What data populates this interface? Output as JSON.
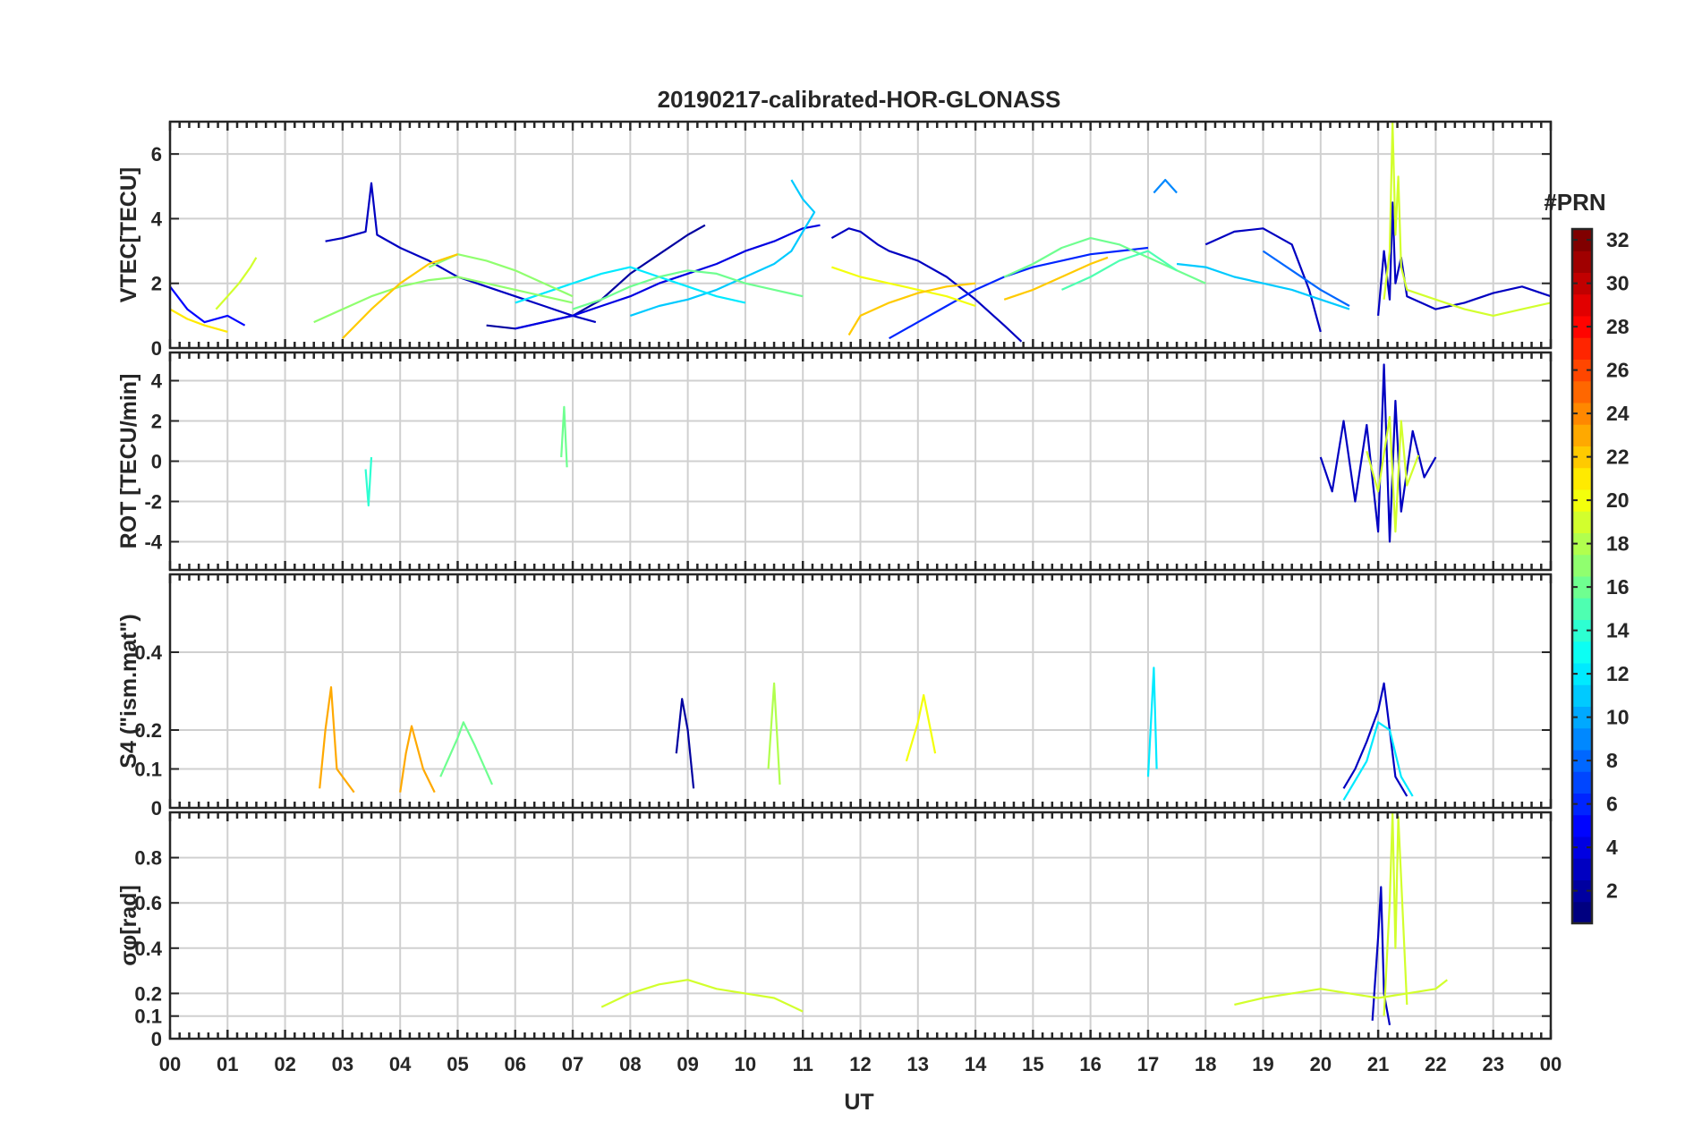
{
  "chart_data": {
    "type": "line",
    "title": "20190217-calibrated-HOR-GLONASS",
    "xlabel": "UT",
    "x_ticks": [
      "00",
      "01",
      "02",
      "03",
      "04",
      "05",
      "06",
      "07",
      "08",
      "09",
      "10",
      "11",
      "12",
      "13",
      "14",
      "15",
      "16",
      "17",
      "18",
      "19",
      "20",
      "21",
      "22",
      "23",
      "00"
    ],
    "xlim": [
      0,
      24
    ],
    "colorbar": {
      "title": "#PRN",
      "ticks": [
        "2",
        "4",
        "6",
        "8",
        "10",
        "12",
        "14",
        "16",
        "18",
        "20",
        "22",
        "24",
        "26",
        "28",
        "30",
        "32"
      ],
      "range": [
        1,
        32
      ],
      "colormap": "jet"
    },
    "panels": [
      {
        "ylabel": "VTEC[TECU]",
        "ylim": [
          0,
          7
        ],
        "yticks": [
          "0",
          "2",
          "4",
          "6"
        ],
        "ytick_values": [
          0,
          2,
          4,
          6
        ],
        "series": [
          {
            "prn": 3,
            "x": [
              2.7,
              3.0,
              3.4,
              3.5,
              3.6,
              4.0,
              4.5,
              5.0,
              5.5,
              6.0,
              6.5,
              7.0,
              7.4
            ],
            "y": [
              3.3,
              3.4,
              3.6,
              5.1,
              3.5,
              3.1,
              2.7,
              2.2,
              1.9,
              1.6,
              1.3,
              1.0,
              0.8
            ]
          },
          {
            "prn": 2,
            "x": [
              5.5,
              6.0,
              6.5,
              7.0,
              7.5,
              8.0,
              8.5,
              9.0,
              9.3
            ],
            "y": [
              0.7,
              0.6,
              0.8,
              1.0,
              1.5,
              2.3,
              2.9,
              3.5,
              3.8
            ]
          },
          {
            "prn": 4,
            "x": [
              6.0,
              6.5,
              7.0,
              7.5,
              8.0,
              8.5,
              9.0,
              9.5,
              10.0,
              10.5,
              11.0,
              11.3
            ],
            "y": [
              0.6,
              0.8,
              1.0,
              1.3,
              1.6,
              2.0,
              2.3,
              2.6,
              3.0,
              3.3,
              3.7,
              3.8
            ]
          },
          {
            "prn": 3,
            "x": [
              11.5,
              11.8,
              12.0,
              12.3,
              12.5,
              13.0,
              13.5,
              14.0,
              14.5,
              14.8
            ],
            "y": [
              3.4,
              3.7,
              3.6,
              3.2,
              3.0,
              2.7,
              2.2,
              1.5,
              0.7,
              0.2
            ]
          },
          {
            "prn": 6,
            "x": [
              12.5,
              13.0,
              13.5,
              14.0,
              14.5,
              15.0,
              15.5,
              16.0,
              16.5,
              17.0
            ],
            "y": [
              0.3,
              0.8,
              1.3,
              1.8,
              2.2,
              2.5,
              2.7,
              2.9,
              3.0,
              3.1
            ]
          },
          {
            "prn": 3,
            "x": [
              18.0,
              18.5,
              19.0,
              19.5,
              19.8,
              20.0
            ],
            "y": [
              3.2,
              3.6,
              3.7,
              3.2,
              1.8,
              0.5
            ]
          },
          {
            "prn": 3,
            "x": [
              21.0,
              21.1,
              21.2,
              21.25,
              21.3,
              21.4,
              21.5,
              22.0,
              22.5,
              23.0,
              23.5,
              24.0
            ],
            "y": [
              1.0,
              3.0,
              1.5,
              4.5,
              2.0,
              2.8,
              1.6,
              1.2,
              1.4,
              1.7,
              1.9,
              1.6
            ]
          },
          {
            "prn": 9,
            "x": [
              17.1,
              17.3,
              17.5
            ],
            "y": [
              4.8,
              5.2,
              4.8
            ]
          },
          {
            "prn": 11,
            "x": [
              10.8,
              11.0,
              11.2,
              11.0,
              10.8,
              10.5,
              10.0,
              9.5,
              9.0,
              8.5,
              8.0
            ],
            "y": [
              5.2,
              4.6,
              4.2,
              3.6,
              3.0,
              2.6,
              2.2,
              1.8,
              1.5,
              1.3,
              1.0
            ]
          },
          {
            "prn": 12,
            "x": [
              6.0,
              6.5,
              7.0,
              7.5,
              8.0,
              8.5,
              9.0,
              9.5,
              10.0
            ],
            "y": [
              1.4,
              1.7,
              2.0,
              2.3,
              2.5,
              2.2,
              1.9,
              1.6,
              1.4
            ]
          },
          {
            "prn": 11,
            "x": [
              17.5,
              18.0,
              18.5,
              19.0,
              19.5,
              20.0,
              20.5
            ],
            "y": [
              2.6,
              2.5,
              2.2,
              2.0,
              1.8,
              1.5,
              1.2
            ]
          },
          {
            "prn": 17,
            "x": [
              2.5,
              3.0,
              3.5,
              4.0,
              4.5,
              5.0,
              5.5,
              6.0,
              6.5,
              7.0
            ],
            "y": [
              0.8,
              1.2,
              1.6,
              1.9,
              2.1,
              2.2,
              2.0,
              1.8,
              1.6,
              1.4
            ]
          },
          {
            "prn": 16,
            "x": [
              7.0,
              7.5,
              8.0,
              8.5,
              9.0,
              9.5,
              10.0,
              10.5,
              11.0
            ],
            "y": [
              1.2,
              1.5,
              1.9,
              2.2,
              2.4,
              2.3,
              2.0,
              1.8,
              1.6
            ]
          },
          {
            "prn": 16,
            "x": [
              14.5,
              15.0,
              15.5,
              16.0,
              16.5,
              17.0,
              17.5,
              18.0
            ],
            "y": [
              2.2,
              2.6,
              3.1,
              3.4,
              3.2,
              2.8,
              2.4,
              2.0
            ]
          },
          {
            "prn": 15,
            "x": [
              15.5,
              16.0,
              16.5,
              17.0,
              17.5
            ],
            "y": [
              1.8,
              2.2,
              2.7,
              3.0,
              2.4
            ]
          },
          {
            "prn": 17,
            "x": [
              4.5,
              5.0,
              5.5,
              6.0,
              6.5,
              7.0
            ],
            "y": [
              2.5,
              2.9,
              2.7,
              2.4,
              2.0,
              1.6
            ]
          },
          {
            "prn": 19,
            "x": [
              0.8,
              1.0,
              1.2,
              1.4,
              1.5
            ],
            "y": [
              1.2,
              1.6,
              2.0,
              2.5,
              2.8
            ]
          },
          {
            "prn": 20,
            "x": [
              11.5,
              12.0,
              12.5,
              13.0,
              13.5,
              14.0
            ],
            "y": [
              2.5,
              2.2,
              2.0,
              1.8,
              1.6,
              1.3
            ]
          },
          {
            "prn": 19,
            "x": [
              21.1,
              21.2,
              21.25,
              21.3,
              21.35,
              21.4,
              21.5,
              22.0,
              22.5,
              23.0,
              23.5,
              24.0
            ],
            "y": [
              1.5,
              3.0,
              7.0,
              3.5,
              5.3,
              2.5,
              1.8,
              1.5,
              1.2,
              1.0,
              1.2,
              1.4
            ]
          },
          {
            "prn": 22,
            "x": [
              3.0,
              3.5,
              4.0,
              4.5,
              5.0
            ],
            "y": [
              0.3,
              1.2,
              2.0,
              2.6,
              2.9
            ]
          },
          {
            "prn": 22,
            "x": [
              11.8,
              12.0,
              12.5,
              13.0,
              13.5,
              14.0
            ],
            "y": [
              0.4,
              1.0,
              1.4,
              1.7,
              1.9,
              2.0
            ]
          },
          {
            "prn": 22,
            "x": [
              14.5,
              15.0,
              15.5,
              16.0,
              16.3
            ],
            "y": [
              1.5,
              1.8,
              2.2,
              2.6,
              2.8
            ]
          },
          {
            "prn": 21,
            "x": [
              0.0,
              0.3,
              0.6,
              1.0
            ],
            "y": [
              1.2,
              0.9,
              0.7,
              0.5
            ]
          },
          {
            "prn": 5,
            "x": [
              0.0,
              0.3,
              0.6,
              1.0,
              1.3
            ],
            "y": [
              1.9,
              1.2,
              0.8,
              1.0,
              0.7
            ]
          },
          {
            "prn": 8,
            "x": [
              19.0,
              19.5,
              20.0,
              20.5
            ],
            "y": [
              3.0,
              2.4,
              1.8,
              1.3
            ]
          }
        ]
      },
      {
        "ylabel": "ROT [TECU/min]",
        "ylim": [
          -5.4,
          5.4
        ],
        "yticks": [
          "-4",
          "-2",
          "0",
          "2",
          "4"
        ],
        "ytick_values": [
          -4,
          -2,
          0,
          2,
          4
        ],
        "series": [
          {
            "prn": 3,
            "x": [
              20.0,
              20.2,
              20.4,
              20.6,
              20.8,
              21.0,
              21.1,
              21.2,
              21.3,
              21.4,
              21.6,
              21.8,
              22.0
            ],
            "y": [
              0.2,
              -1.5,
              2.0,
              -2.0,
              1.8,
              -3.5,
              4.8,
              -4.0,
              3.0,
              -2.5,
              1.5,
              -0.8,
              0.2
            ]
          },
          {
            "prn": 19,
            "x": [
              20.8,
              21.0,
              21.2,
              21.3,
              21.4,
              21.5,
              21.7
            ],
            "y": [
              0.5,
              -1.5,
              2.2,
              -3.5,
              2.0,
              -1.2,
              0.3
            ]
          },
          {
            "prn": 16,
            "x": [
              6.8,
              6.85,
              6.9
            ],
            "y": [
              0.2,
              2.7,
              -0.3
            ]
          },
          {
            "prn": 14,
            "x": [
              3.4,
              3.45,
              3.5
            ],
            "y": [
              -0.4,
              -2.2,
              0.2
            ]
          }
        ]
      },
      {
        "ylabel": "S4 (\"ism.mat\")",
        "ylim": [
          0,
          0.6
        ],
        "yticks": [
          "0",
          "0.1",
          "0.2",
          "0.4"
        ],
        "ytick_values": [
          0,
          0.1,
          0.2,
          0.4
        ],
        "series": [
          {
            "prn": 23,
            "x": [
              2.6,
              2.7,
              2.8,
              2.9,
              3.2
            ],
            "y": [
              0.05,
              0.2,
              0.31,
              0.1,
              0.04
            ]
          },
          {
            "prn": 23,
            "x": [
              4.0,
              4.1,
              4.2,
              4.4,
              4.6
            ],
            "y": [
              0.04,
              0.14,
              0.21,
              0.1,
              0.04
            ]
          },
          {
            "prn": 16,
            "x": [
              4.7,
              5.0,
              5.1,
              5.3,
              5.6
            ],
            "y": [
              0.08,
              0.18,
              0.22,
              0.16,
              0.06
            ]
          },
          {
            "prn": 2,
            "x": [
              8.8,
              8.9,
              9.0,
              9.1
            ],
            "y": [
              0.14,
              0.28,
              0.2,
              0.05
            ]
          },
          {
            "prn": 18,
            "x": [
              10.4,
              10.5,
              10.6
            ],
            "y": [
              0.1,
              0.32,
              0.06
            ]
          },
          {
            "prn": 20,
            "x": [
              12.8,
              13.0,
              13.1,
              13.3
            ],
            "y": [
              0.12,
              0.22,
              0.29,
              0.14
            ]
          },
          {
            "prn": 12,
            "x": [
              17.0,
              17.1,
              17.15
            ],
            "y": [
              0.08,
              0.36,
              0.1
            ]
          },
          {
            "prn": 3,
            "x": [
              20.4,
              20.6,
              20.8,
              21.0,
              21.1,
              21.2,
              21.3,
              21.5
            ],
            "y": [
              0.05,
              0.1,
              0.17,
              0.25,
              0.32,
              0.2,
              0.08,
              0.03
            ]
          },
          {
            "prn": 12,
            "x": [
              20.4,
              20.8,
              21.0,
              21.2,
              21.4,
              21.6
            ],
            "y": [
              0.02,
              0.12,
              0.22,
              0.2,
              0.08,
              0.03
            ]
          }
        ]
      },
      {
        "ylabel": "σφ[rad]",
        "ylim": [
          0,
          1.0
        ],
        "yticks": [
          "0",
          "0.1",
          "0.2",
          "0.4",
          "0.6",
          "0.8"
        ],
        "ytick_values": [
          0,
          0.1,
          0.2,
          0.4,
          0.6,
          0.8
        ],
        "series": [
          {
            "prn": 3,
            "x": [
              20.9,
              21.0,
              21.05,
              21.1,
              21.2
            ],
            "y": [
              0.08,
              0.45,
              0.67,
              0.2,
              0.06
            ]
          },
          {
            "prn": 19,
            "x": [
              21.1,
              21.2,
              21.25,
              21.3,
              21.35,
              21.5
            ],
            "y": [
              0.1,
              0.6,
              1.0,
              0.4,
              0.98,
              0.15
            ]
          },
          {
            "prn": 19,
            "x": [
              7.5,
              8.0,
              8.5,
              9.0,
              9.5,
              10.0,
              10.5,
              11.0
            ],
            "y": [
              0.14,
              0.2,
              0.24,
              0.26,
              0.22,
              0.2,
              0.18,
              0.12
            ]
          },
          {
            "prn": 19,
            "x": [
              18.5,
              19.0,
              19.5,
              20.0,
              20.5,
              21.0,
              21.5,
              22.0,
              22.2
            ],
            "y": [
              0.15,
              0.18,
              0.2,
              0.22,
              0.2,
              0.18,
              0.2,
              0.22,
              0.26
            ]
          }
        ]
      }
    ]
  }
}
